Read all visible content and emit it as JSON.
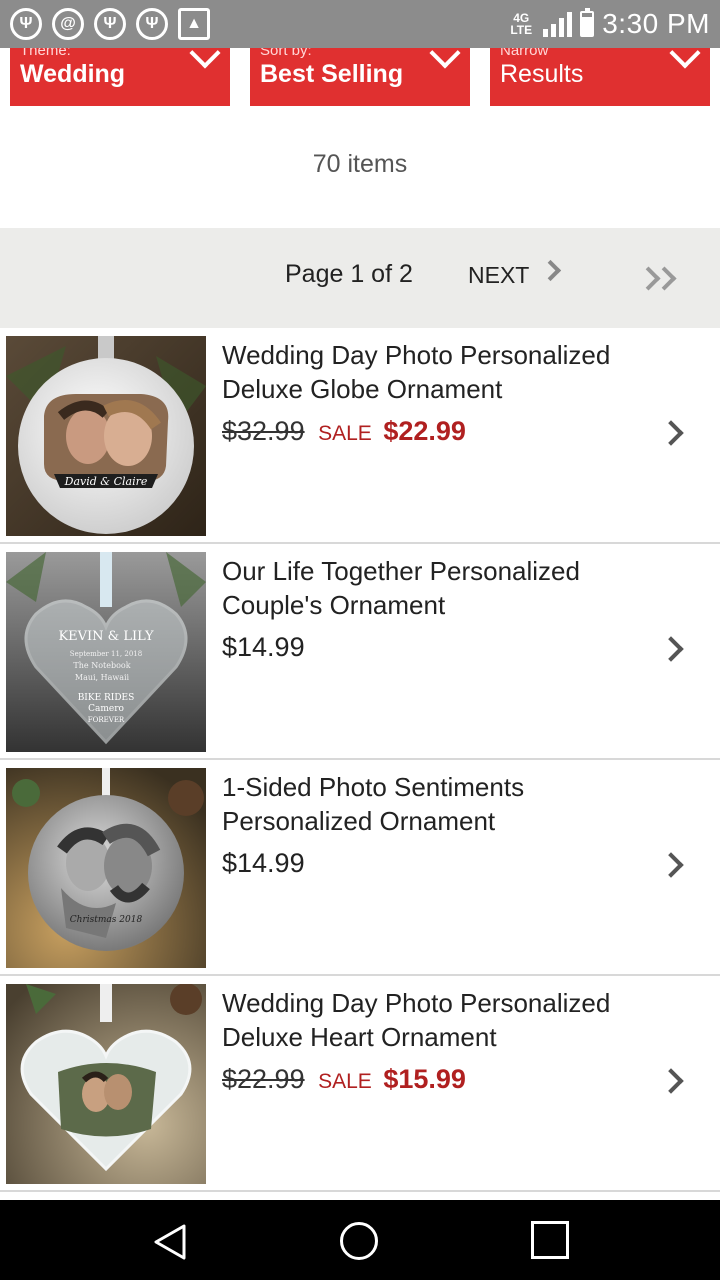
{
  "status_bar": {
    "time": "3:30 PM",
    "network": "4G LTE",
    "notification_icons": [
      "app-icon",
      "swirl-icon",
      "app-icon",
      "app-icon",
      "image-icon"
    ]
  },
  "filters": [
    {
      "label": "Theme:",
      "value": "Wedding"
    },
    {
      "label": "Sort by:",
      "value": "Best Selling"
    },
    {
      "label": "Narrow",
      "value": "Results"
    }
  ],
  "items_count": "70 items",
  "pagination": {
    "page_label": "Page 1 of 2",
    "next_label": "NEXT"
  },
  "products": [
    {
      "title": "Wedding Day Photo Personalized Deluxe Globe Ornament",
      "original_price": "$32.99",
      "sale_label": "SALE",
      "price": "$22.99",
      "on_sale": true
    },
    {
      "title": "Our Life Together Personalized Couple's Ornament",
      "price": "$14.99",
      "on_sale": false
    },
    {
      "title": "1-Sided Photo Sentiments Personalized Ornament",
      "price": "$14.99",
      "on_sale": false
    },
    {
      "title": "Wedding Day Photo Personalized Deluxe Heart Ornament",
      "original_price": "$22.99",
      "sale_label": "SALE",
      "price": "$15.99",
      "on_sale": true
    }
  ],
  "thumb_text": {
    "p0": "David & Claire",
    "p1_name": "KEVIN & LILY",
    "p1_line1": "September 11, 2018",
    "p1_line2": "The Notebook",
    "p1_line3": "Maui, Hawaii",
    "p1_line4": "BIKE RIDES",
    "p1_line5": "Camero",
    "p1_line6": "FOREVER",
    "p2": "Christmas 2018"
  },
  "colors": {
    "accent_red": "#e03030",
    "sale_red": "#b02020",
    "status_bar": "#8c8c8c",
    "pager_bg": "#ececea"
  }
}
